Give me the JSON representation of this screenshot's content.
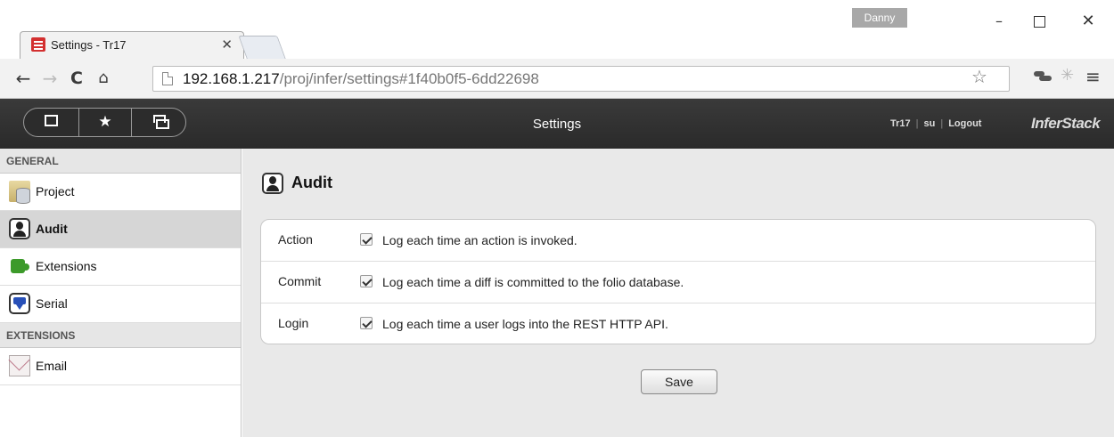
{
  "browser": {
    "tab_title": "Settings - Tr17",
    "tab_close": "✕",
    "user_badge": "Danny",
    "window_controls": {
      "minimize": "–",
      "close": "✕"
    },
    "nav": {
      "back": "←",
      "forward": "→",
      "reload": "C",
      "home": "⌂"
    },
    "url_host": "192.168.1.217",
    "url_path": "/proj/infer/settings#1f40b0f5-6dd22698",
    "icons": [
      "star-icon",
      "extension-icon",
      "snowflake-icon",
      "menu-icon"
    ],
    "star": "☆",
    "snowflake": "✳",
    "menu": "≡"
  },
  "app_header": {
    "title": "Settings",
    "links": {
      "project": "Tr17",
      "user": "su",
      "logout": "Logout"
    },
    "brand": "InferStack",
    "segmented": [
      "square-icon",
      "star-icon",
      "windows-icon"
    ],
    "star": "★"
  },
  "sidebar": {
    "sections": [
      {
        "title": "GENERAL",
        "items": [
          {
            "label": "Project",
            "icon": "project-icon",
            "active": false
          },
          {
            "label": "Audit",
            "icon": "audit-icon",
            "active": true
          },
          {
            "label": "Extensions",
            "icon": "extensions-icon",
            "active": false
          },
          {
            "label": "Serial",
            "icon": "serial-icon",
            "active": false
          }
        ]
      },
      {
        "title": "EXTENSIONS",
        "items": [
          {
            "label": "Email",
            "icon": "email-icon",
            "active": false
          }
        ]
      }
    ]
  },
  "main": {
    "title": "Audit",
    "settings": [
      {
        "name": "Action",
        "checked": true,
        "description": "Log each time an action is invoked."
      },
      {
        "name": "Commit",
        "checked": true,
        "description": "Log each time a diff is committed to the folio database."
      },
      {
        "name": "Login",
        "checked": true,
        "description": "Log each time a user logs into the REST HTTP API."
      }
    ],
    "save_label": "Save"
  }
}
